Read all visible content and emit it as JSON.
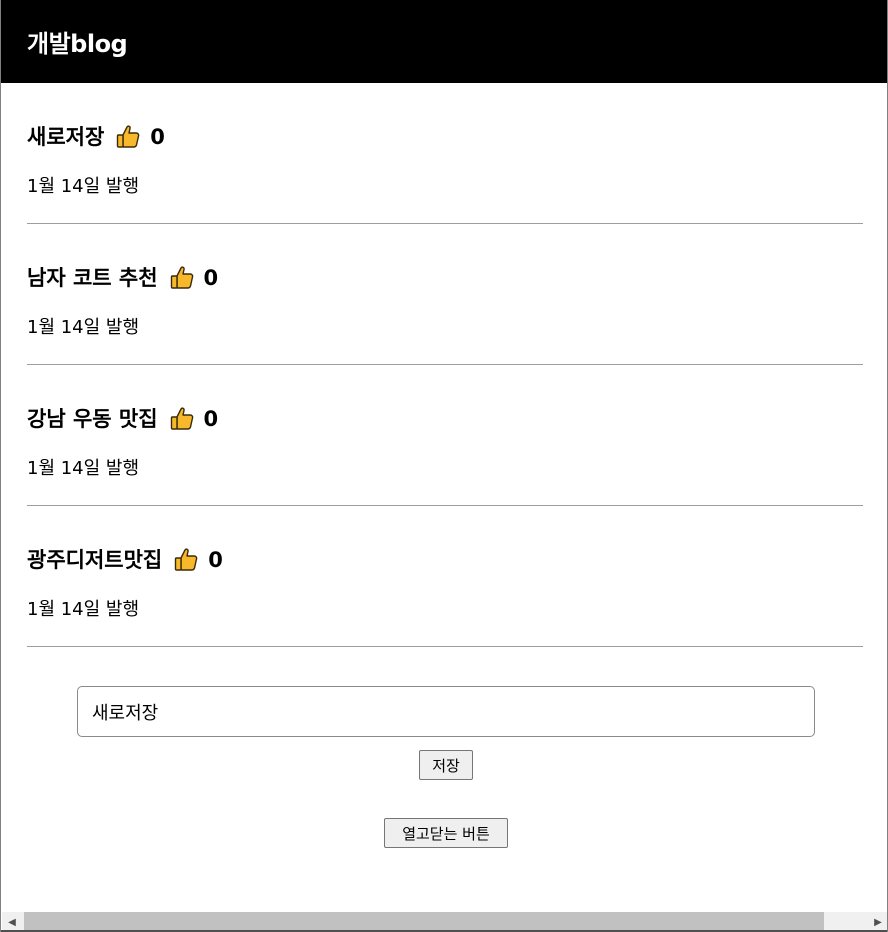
{
  "header": {
    "title": "개발blog"
  },
  "posts": [
    {
      "title": "새로저장",
      "likes": "0",
      "date": "1월 14일 발행"
    },
    {
      "title": "남자 코트 추천",
      "likes": "0",
      "date": "1월 14일 발행"
    },
    {
      "title": "강남 우동 맛집",
      "likes": "0",
      "date": "1월 14일 발행"
    },
    {
      "title": "광주디저트맛집",
      "likes": "0",
      "date": "1월 14일 발행"
    }
  ],
  "form": {
    "input_value": "새로저장",
    "save_label": "저장",
    "toggle_label": "열고닫는 버튼"
  },
  "icons": {
    "like": "thumbs-up-icon"
  },
  "colors": {
    "header_bg": "#000000",
    "header_text": "#ffffff",
    "thumb_fill": "#f7b92b"
  }
}
